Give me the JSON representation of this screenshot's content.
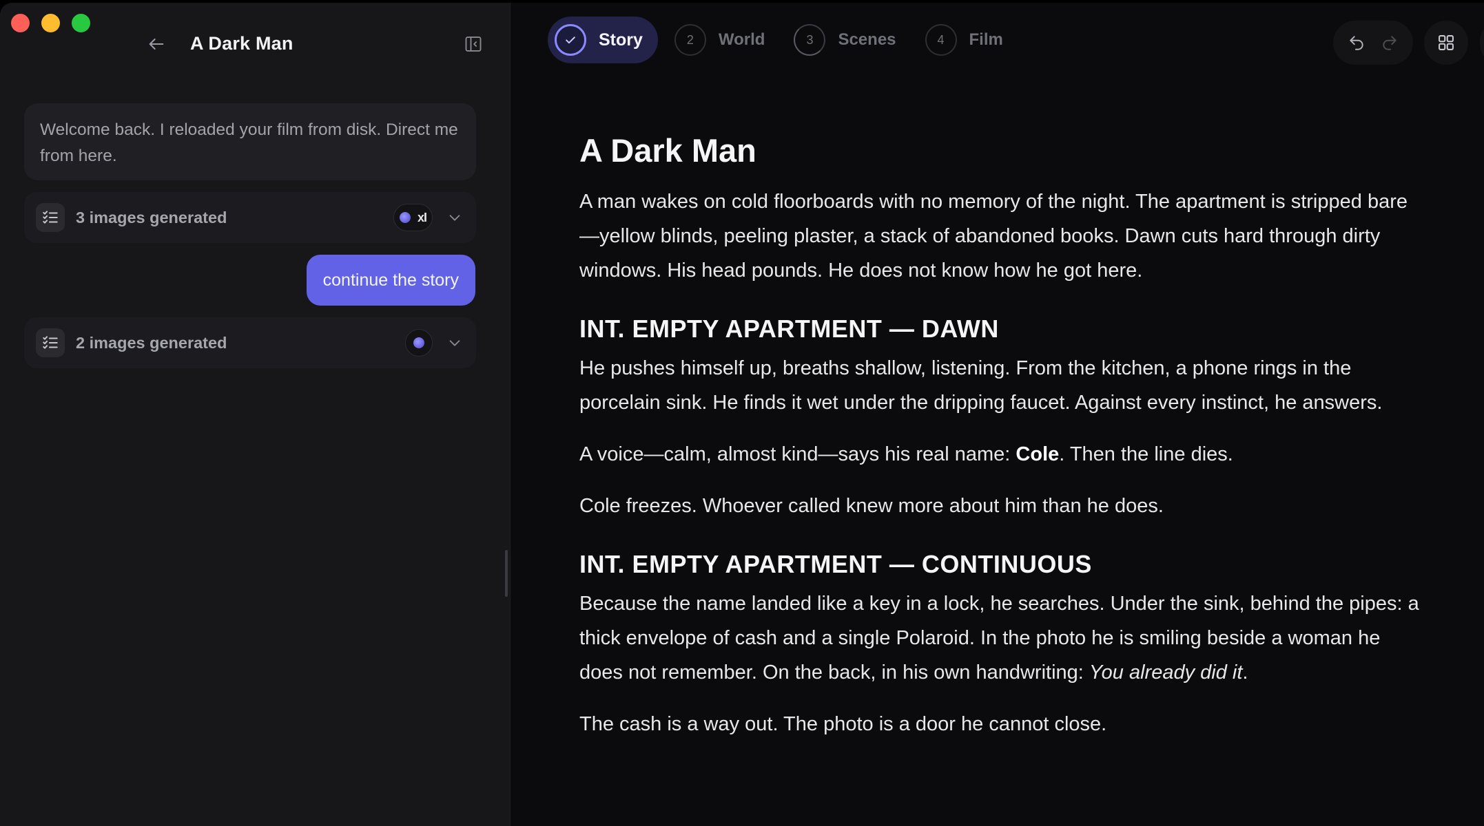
{
  "sidebar": {
    "project_title": "A Dark Man",
    "messages": {
      "assistant_welcome": "Welcome back. I reloaded your film from disk. Direct me from here.",
      "generation_1": {
        "label": "3 images generated",
        "model_glyph": "xI"
      },
      "user_1": "continue the story",
      "generation_2": {
        "label": "2 images generated"
      }
    }
  },
  "steps": [
    {
      "number": "✓",
      "label": "Story",
      "active": true
    },
    {
      "number": "2",
      "label": "World"
    },
    {
      "number": "3",
      "label": "Scenes"
    },
    {
      "number": "4",
      "label": "Film"
    }
  ],
  "document": {
    "title": "A Dark Man",
    "intro": "A man wakes on cold floorboards with no memory of the night. The apartment is stripped bare—yellow blinds, peeling plaster, a stack of abandoned books. Dawn cuts hard through dirty windows. His head pounds. He does not know how he got here.",
    "scene1": {
      "heading": "INT. EMPTY APARTMENT — DAWN",
      "p1": "He pushes himself up, breaths shallow, listening. From the kitchen, a phone rings in the porcelain sink. He finds it wet under the dripping faucet. Against every instinct, he answers.",
      "p2_before": "A voice—calm, almost kind—says his real name: ",
      "p2_name": "Cole",
      "p2_after": ". Then the line dies.",
      "p3": "Cole freezes. Whoever called knew more about him than he does."
    },
    "scene2": {
      "heading": "INT. EMPTY APARTMENT — CONTINUOUS",
      "p1_before": "Because the name landed like a key in a lock, he searches. Under the sink, behind the pipes: a thick envelope of cash and a single Polaroid. In the photo he is smiling beside a woman he does not remember. On the back, in his own handwriting: ",
      "p1_italic": "You already did it",
      "p1_after": ".",
      "p2": "The cash is a way out. The photo is a door he cannot close."
    }
  },
  "colors": {
    "accent": "#6262e6",
    "active_ring": "#8b89ff",
    "sidebar_bg": "#17171a",
    "main_bg": "#0b0b0d"
  }
}
